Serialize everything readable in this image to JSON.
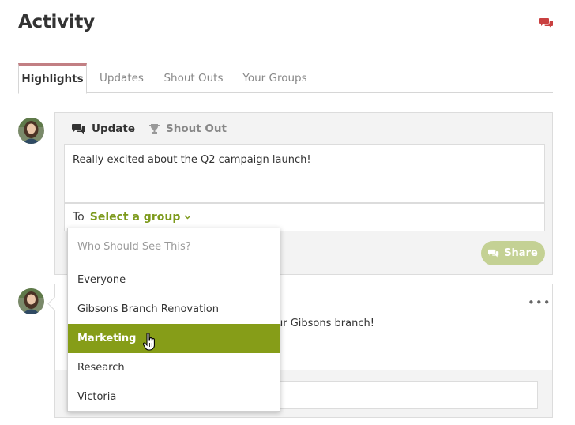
{
  "page": {
    "title": "Activity"
  },
  "header": {
    "icon": "chat-bubbles-icon",
    "accent_color": "#c0392b"
  },
  "tabs": [
    {
      "label": "Highlights",
      "active": true
    },
    {
      "label": "Updates",
      "active": false
    },
    {
      "label": "Shout Outs",
      "active": false
    },
    {
      "label": "Your Groups",
      "active": false
    }
  ],
  "composer": {
    "tabs": [
      {
        "label": "Update",
        "icon": "chat-bubbles-icon",
        "active": true
      },
      {
        "label": "Shout Out",
        "icon": "trophy-icon",
        "active": false
      }
    ],
    "text": "Really excited about the Q2 campaign launch!",
    "to_label": "To",
    "group_select": "Select a group",
    "share_label": "Share",
    "share_color": "#c4d194"
  },
  "post": {
    "more_label": "•••",
    "text_fragment": "ur Gibsons branch!"
  },
  "dropdown": {
    "header": "Who Should See This?",
    "items": [
      "Everyone",
      "Gibsons Branch Renovation",
      "Marketing",
      "Research",
      "Victoria"
    ],
    "selected": "Marketing",
    "selected_color": "#869d18"
  }
}
